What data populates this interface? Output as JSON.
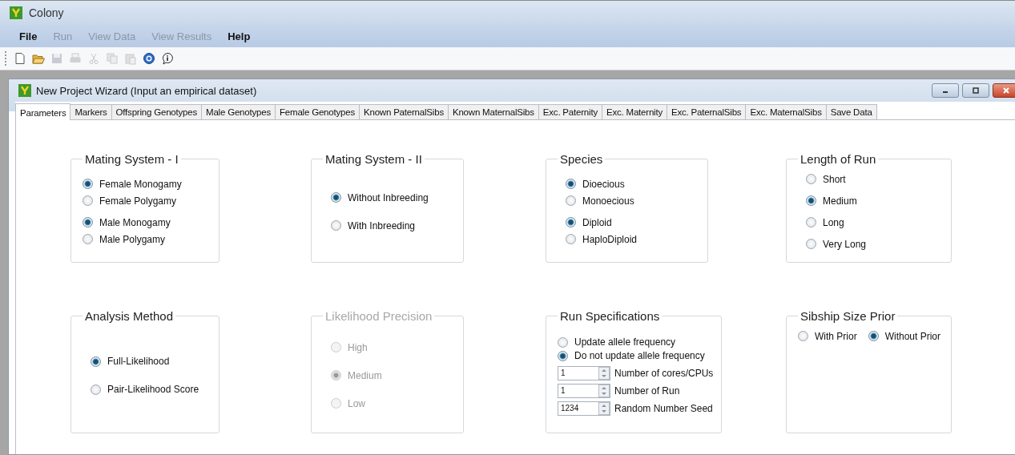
{
  "app": {
    "title": "Colony"
  },
  "menu": [
    {
      "label": "File",
      "disabled": false
    },
    {
      "label": "Run",
      "disabled": true
    },
    {
      "label": "View Data",
      "disabled": true
    },
    {
      "label": "View Results",
      "disabled": true
    },
    {
      "label": "Help",
      "disabled": false
    }
  ],
  "toolbar": [
    {
      "kind": "new",
      "disabled": false
    },
    {
      "kind": "open",
      "disabled": false
    },
    {
      "kind": "save",
      "disabled": true
    },
    {
      "kind": "print",
      "disabled": true
    },
    {
      "kind": "cut",
      "disabled": true
    },
    {
      "kind": "copy",
      "disabled": true
    },
    {
      "kind": "paste",
      "disabled": true
    },
    {
      "kind": "help",
      "disabled": false
    },
    {
      "kind": "info",
      "disabled": false
    }
  ],
  "wizard": {
    "title": "New Project Wizard (Input an empirical dataset)"
  },
  "tabs": [
    {
      "label": "Parameters",
      "selected": true
    },
    {
      "label": "Markers",
      "selected": false
    },
    {
      "label": "Offspring Genotypes",
      "selected": false
    },
    {
      "label": "Male Genotypes",
      "selected": false
    },
    {
      "label": "Female Genotypes",
      "selected": false
    },
    {
      "label": "Known PaternalSibs",
      "selected": false
    },
    {
      "label": "Known MaternalSibs",
      "selected": false
    },
    {
      "label": "Exc. Paternity",
      "selected": false
    },
    {
      "label": "Exc. Maternity",
      "selected": false
    },
    {
      "label": "Exc. PaternalSibs",
      "selected": false
    },
    {
      "label": "Exc. MaternalSibs",
      "selected": false
    },
    {
      "label": "Save Data",
      "selected": false
    }
  ],
  "groups": [
    {
      "title": "Mating System - I",
      "disabled": false,
      "sections": [
        {
          "kind": "radios",
          "options": [
            {
              "label": "Female Monogamy",
              "selected": true
            },
            {
              "label": "Female Polygamy",
              "selected": false
            }
          ]
        },
        {
          "kind": "radios",
          "options": [
            {
              "label": "Male Monogamy",
              "selected": true
            },
            {
              "label": "Male Polygamy",
              "selected": false
            }
          ]
        }
      ]
    },
    {
      "title": "Mating System - II",
      "disabled": false,
      "sections": [
        {
          "kind": "radios-wide",
          "options": [
            {
              "label": "Without Inbreeding",
              "selected": true
            },
            {
              "label": "With Inbreeding",
              "selected": false
            }
          ]
        }
      ]
    },
    {
      "title": "Species",
      "disabled": false,
      "sections": [
        {
          "kind": "radios",
          "options": [
            {
              "label": "Dioecious",
              "selected": true
            },
            {
              "label": "Monoecious",
              "selected": false
            }
          ]
        },
        {
          "kind": "radios",
          "options": [
            {
              "label": "Diploid",
              "selected": true
            },
            {
              "label": "HaploDiploid",
              "selected": false
            }
          ]
        }
      ]
    },
    {
      "title": "Length of Run",
      "disabled": false,
      "sections": [
        {
          "kind": "radios",
          "options": [
            {
              "label": "Short",
              "selected": false
            },
            {
              "label": "Medium",
              "selected": true
            },
            {
              "label": "Long",
              "selected": false
            },
            {
              "label": "Very Long",
              "selected": false
            }
          ]
        }
      ]
    },
    {
      "title": "Analysis Method",
      "disabled": false,
      "sections": [
        {
          "kind": "radios-wide",
          "options": [
            {
              "label": "Full-Likelihood",
              "selected": true
            },
            {
              "label": "Pair-Likelihood Score",
              "selected": false
            }
          ]
        }
      ]
    },
    {
      "title": "Likelihood Precision",
      "disabled": true,
      "sections": [
        {
          "kind": "radios-wide",
          "options": [
            {
              "label": "High",
              "selected": false
            },
            {
              "label": "Medium",
              "selected": true
            },
            {
              "label": "Low",
              "selected": false
            }
          ]
        }
      ]
    },
    {
      "title": "Run Specifications",
      "disabled": false,
      "sections": [
        {
          "kind": "radios",
          "options": [
            {
              "label": "Update allele frequency",
              "selected": false
            },
            {
              "label": "Do not update allele frequency",
              "selected": true
            }
          ]
        },
        {
          "kind": "spinner",
          "value": "1",
          "label": "Number of cores/CPUs"
        },
        {
          "kind": "spinner",
          "value": "1",
          "label": "Number of Run"
        },
        {
          "kind": "spinner",
          "value": "1234",
          "label": "Random Number Seed"
        }
      ]
    },
    {
      "title": "Sibship Size Prior",
      "disabled": false,
      "sections": [
        {
          "kind": "radios-inline",
          "options": [
            {
              "label": "With Prior",
              "selected": false
            },
            {
              "label": "Without Prior",
              "selected": true
            }
          ]
        }
      ]
    }
  ]
}
